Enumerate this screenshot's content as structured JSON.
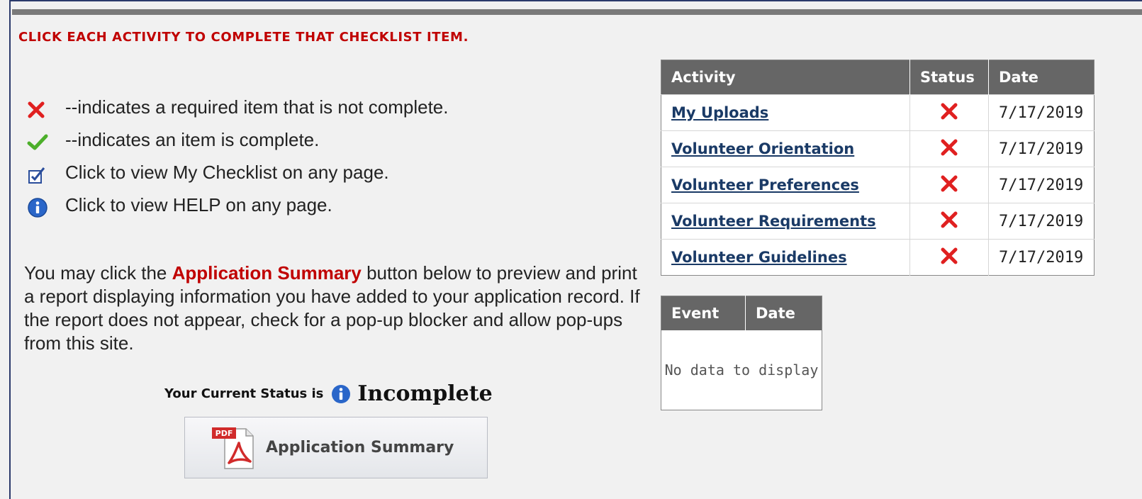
{
  "instruction": "CLICK EACH ACTIVITY TO COMPLETE THAT CHECKLIST ITEM.",
  "legend": [
    {
      "icon": "red-x-icon",
      "text": "--indicates a required item that is not complete."
    },
    {
      "icon": "green-check-icon",
      "text": "--indicates an item is complete."
    },
    {
      "icon": "checklist-icon",
      "text": "Click to view My Checklist on any page."
    },
    {
      "icon": "info-icon",
      "text": "Click to view HELP on any page."
    }
  ],
  "paragraph": {
    "before": "You may click the ",
    "highlight": "Application Summary",
    "after": " button below to preview and print a report displaying information you have added to your application record. If the report does not appear, check for a pop-up blocker and allow pop-ups from this site."
  },
  "status": {
    "label": "Your Current Status is",
    "value": "Incomplete"
  },
  "application_summary_button": {
    "label": "Application Summary",
    "icon": "pdf-icon"
  },
  "activity_table": {
    "headers": [
      "Activity",
      "Status",
      "Date"
    ],
    "rows": [
      {
        "activity": "My Uploads",
        "status": "incomplete",
        "date": "7/17/2019"
      },
      {
        "activity": "Volunteer Orientation",
        "status": "incomplete",
        "date": "7/17/2019"
      },
      {
        "activity": "Volunteer Preferences",
        "status": "incomplete",
        "date": "7/17/2019"
      },
      {
        "activity": "Volunteer Requirements",
        "status": "incomplete",
        "date": "7/17/2019"
      },
      {
        "activity": "Volunteer Guidelines",
        "status": "incomplete",
        "date": "7/17/2019"
      }
    ]
  },
  "event_table": {
    "headers": [
      "Event",
      "Date"
    ],
    "empty_text": "No data to display"
  },
  "colors": {
    "accent_red": "#c00000",
    "header_gray": "#666666",
    "link_blue": "#1a3a66"
  }
}
